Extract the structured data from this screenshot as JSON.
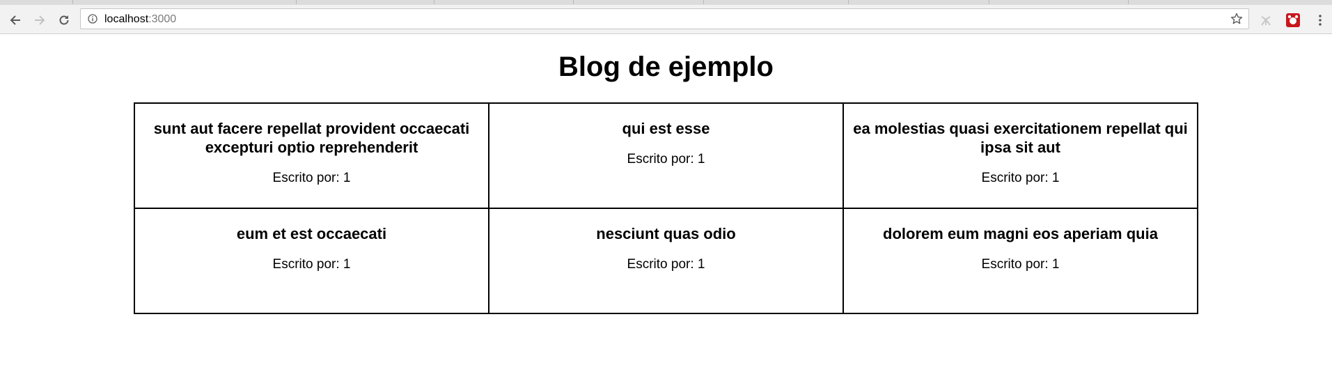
{
  "browser": {
    "url_host": "localhost",
    "url_port": ":3000"
  },
  "page": {
    "title": "Blog de ejemplo"
  },
  "posts": [
    {
      "title": "sunt aut facere repellat provident occaecati excepturi optio reprehenderit",
      "author": "Escrito por: 1"
    },
    {
      "title": "qui est esse",
      "author": "Escrito por: 1"
    },
    {
      "title": "ea molestias quasi exercitationem repellat qui ipsa sit aut",
      "author": "Escrito por: 1"
    },
    {
      "title": "eum et est occaecati",
      "author": "Escrito por: 1"
    },
    {
      "title": "nesciunt quas odio",
      "author": "Escrito por: 1"
    },
    {
      "title": "dolorem eum magni eos aperiam quia",
      "author": "Escrito por: 1"
    }
  ],
  "colors": {
    "toolbar_bg": "#f2f2f2",
    "border": "#000000",
    "url_port": "#7a7a7a"
  },
  "icons": [
    "back-arrow-icon",
    "forward-arrow-icon",
    "reload-icon",
    "info-icon",
    "star-icon",
    "extension-icon",
    "extension-icon-red",
    "menu-dots-icon"
  ]
}
